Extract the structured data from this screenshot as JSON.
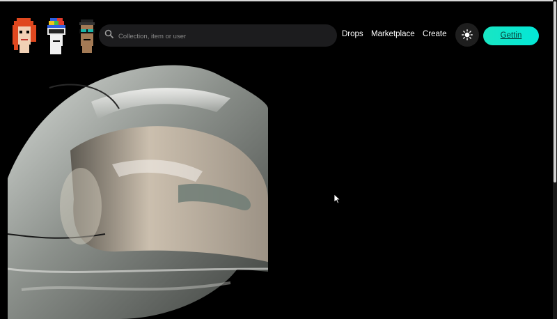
{
  "header": {
    "logos": [
      {
        "icon": "punk-avatar-red-hair-icon"
      },
      {
        "icon": "punk-avatar-propeller-cap-icon"
      },
      {
        "icon": "punk-avatar-sunglasses-icon"
      }
    ],
    "search": {
      "placeholder": "Collection, item or user",
      "value": "",
      "icon": "search-icon"
    },
    "nav": {
      "drops": "Drops",
      "marketplace": "Marketplace",
      "create": "Create"
    },
    "theme_toggle_icon": "sun-icon",
    "cta_label": "Gettin"
  },
  "hero": {
    "media_icon": "nft-3d-artwork"
  },
  "colors": {
    "background": "#000000",
    "accent": "#11e6cd",
    "search_bg": "#1c1c1e"
  }
}
